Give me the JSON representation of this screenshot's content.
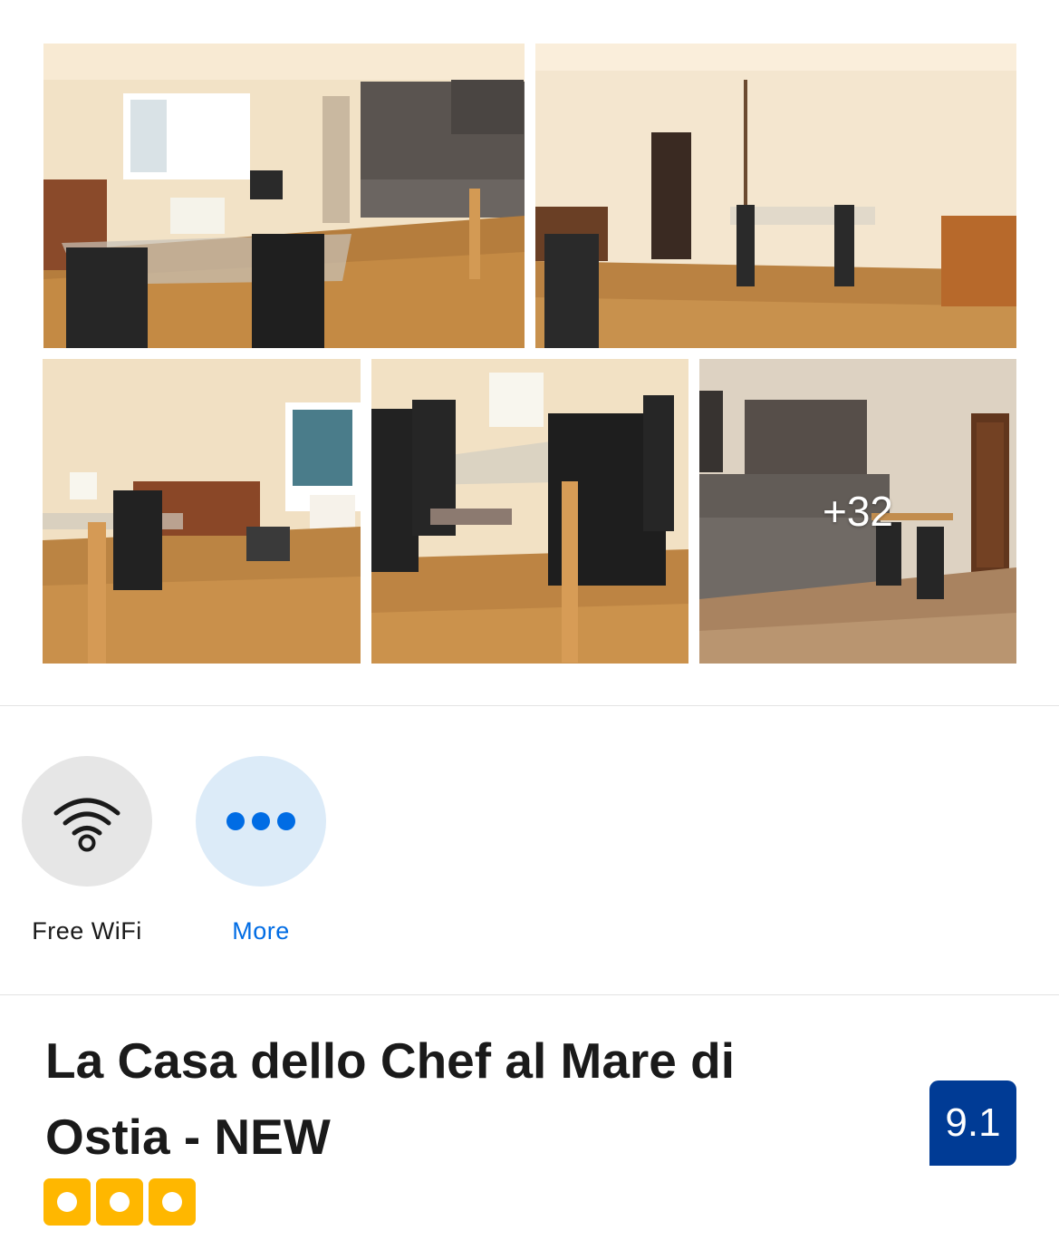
{
  "gallery": {
    "more_photos_label": "+32"
  },
  "facilities": {
    "wifi": {
      "label": "Free WiFi",
      "icon": "wifi-icon",
      "circle_color": "#e6e6e6",
      "text_color": "#1a1a1a"
    },
    "more": {
      "label": "More",
      "icon": "ellipsis-icon",
      "circle_color": "#dcebf8",
      "text_color": "#006ce4"
    }
  },
  "property": {
    "name": "La Casa dello Chef al Mare di Ostia - NEW",
    "review_score": "9.1",
    "star_rating": 3,
    "rating_icon": "yellow-square-dot",
    "score_badge_color": "#003b95",
    "rating_color": "#ffb700"
  }
}
